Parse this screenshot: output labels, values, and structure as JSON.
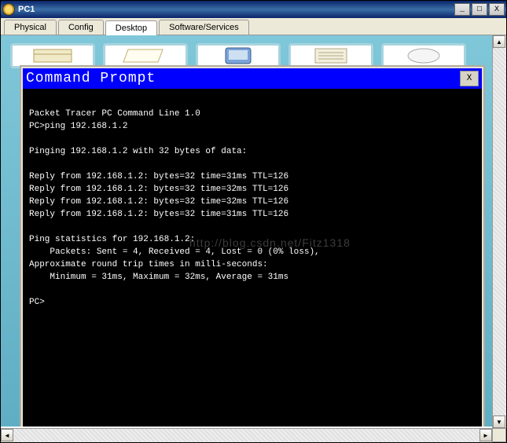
{
  "window": {
    "title": "PC1",
    "buttons": {
      "min": "_",
      "max": "□",
      "close": "X"
    }
  },
  "tabs": [
    {
      "label": "Physical",
      "active": false
    },
    {
      "label": "Config",
      "active": false
    },
    {
      "label": "Desktop",
      "active": true
    },
    {
      "label": "Software/Services",
      "active": false
    }
  ],
  "cmdprompt": {
    "title": "Command Prompt",
    "close": "X",
    "lines": [
      "",
      "Packet Tracer PC Command Line 1.0",
      "PC>ping 192.168.1.2",
      "",
      "Pinging 192.168.1.2 with 32 bytes of data:",
      "",
      "Reply from 192.168.1.2: bytes=32 time=31ms TTL=126",
      "Reply from 192.168.1.2: bytes=32 time=32ms TTL=126",
      "Reply from 192.168.1.2: bytes=32 time=32ms TTL=126",
      "Reply from 192.168.1.2: bytes=32 time=31ms TTL=126",
      "",
      "Ping statistics for 192.168.1.2:",
      "    Packets: Sent = 4, Received = 4, Lost = 0 (0% loss),",
      "Approximate round trip times in milli-seconds:",
      "    Minimum = 31ms, Maximum = 32ms, Average = 31ms",
      "",
      "PC>"
    ]
  },
  "watermark": "http://blog.csdn.net/Fitz1318",
  "scroll": {
    "left": "◄",
    "right": "►",
    "up": "▲",
    "down": "▼"
  }
}
